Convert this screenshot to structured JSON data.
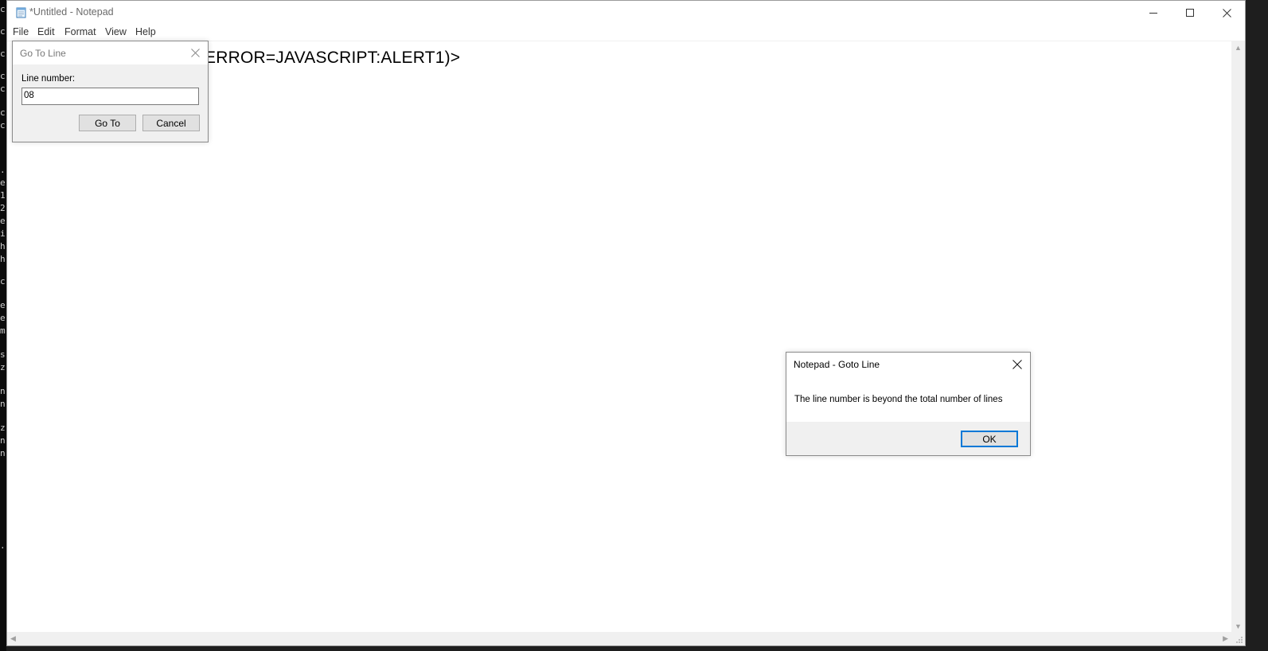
{
  "window": {
    "title": "*Untitled - Notepad"
  },
  "menu": [
    "File",
    "Edit",
    "Format",
    "View",
    "Help"
  ],
  "editor": {
    "visible_text": "ERROR=JAVASCRIPT:ALERT1)>"
  },
  "goto_dialog": {
    "title": "Go To Line",
    "label": "Line number:",
    "value": "08",
    "goto_label": "Go To",
    "cancel_label": "Cancel"
  },
  "error_dialog": {
    "title": "Notepad - Goto Line",
    "message": "The line number is beyond the total number of lines",
    "ok_label": "OK"
  },
  "terminal_fragments": [
    "c",
    "c",
    "c",
    "c",
    "c",
    "c",
    "c",
    ".",
    "e",
    "1",
    "2",
    "e",
    "i",
    "h",
    "h",
    "c",
    "e",
    "e",
    "m",
    "s",
    "z",
    "n",
    "n",
    "z",
    "n",
    "n",
    "."
  ],
  "colors": {
    "accent": "#0078d7",
    "dialog_bg": "#f0f0f0",
    "terminal_bg": "#0c0c0c"
  }
}
